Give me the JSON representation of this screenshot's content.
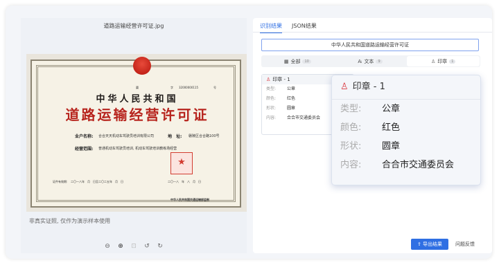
{
  "left": {
    "file_title": "道路运输经营许可证.jpg",
    "certificate": {
      "country_title": "中华人民共和国",
      "main_title": "道路运输经营许可证",
      "word_label": "字",
      "word_value": "32000000115",
      "hao_label": "号",
      "ji_label": "冀",
      "owner_label": "业户名称:",
      "owner_value": "合合天天机动车驾驶员培训有限公司",
      "address_label": "地　址:",
      "address_value": "磐陵区合合路100号",
      "scope_label": "经营范围:",
      "scope_value": "普通机动车驾驶员培训, 机动车驾驶培训教练场经营",
      "validity_label": "证件有效期:",
      "validity_value": "二〇一八年　月　日至二〇二五年　月　日",
      "issue_date": "二〇一八　年　八　月　日",
      "footer": "中华人民共和国交通运输部监制"
    },
    "disclaimer": "非真实证照, 仅作为演示样本使用",
    "tools": [
      "zoom-out-icon",
      "zoom-in-icon",
      "fit-icon",
      "rotate-left-icon",
      "rotate-right-icon"
    ]
  },
  "right": {
    "tabs": [
      {
        "label": "识别结果"
      },
      {
        "label": "JSON结果"
      }
    ],
    "doc_title": "中华人民共和国道路运输经营许可证",
    "filters": [
      {
        "label": "全部",
        "count": "10"
      },
      {
        "label": "文本",
        "count": "9"
      },
      {
        "label": "印章",
        "count": "1"
      }
    ],
    "card": {
      "title": "印章 - 1",
      "rows": [
        {
          "k": "类型:",
          "v": "公章"
        },
        {
          "k": "颜色:",
          "v": "红色"
        },
        {
          "k": "形状:",
          "v": "圆章"
        },
        {
          "k": "内容:",
          "v": "合合市交通委员会"
        }
      ]
    },
    "export_label": "导出结果",
    "feedback_label": "问题反馈"
  },
  "colors": {
    "accent": "#2f6fe3",
    "seal_red": "#d9363e",
    "cert_title_red": "#b7241d"
  }
}
